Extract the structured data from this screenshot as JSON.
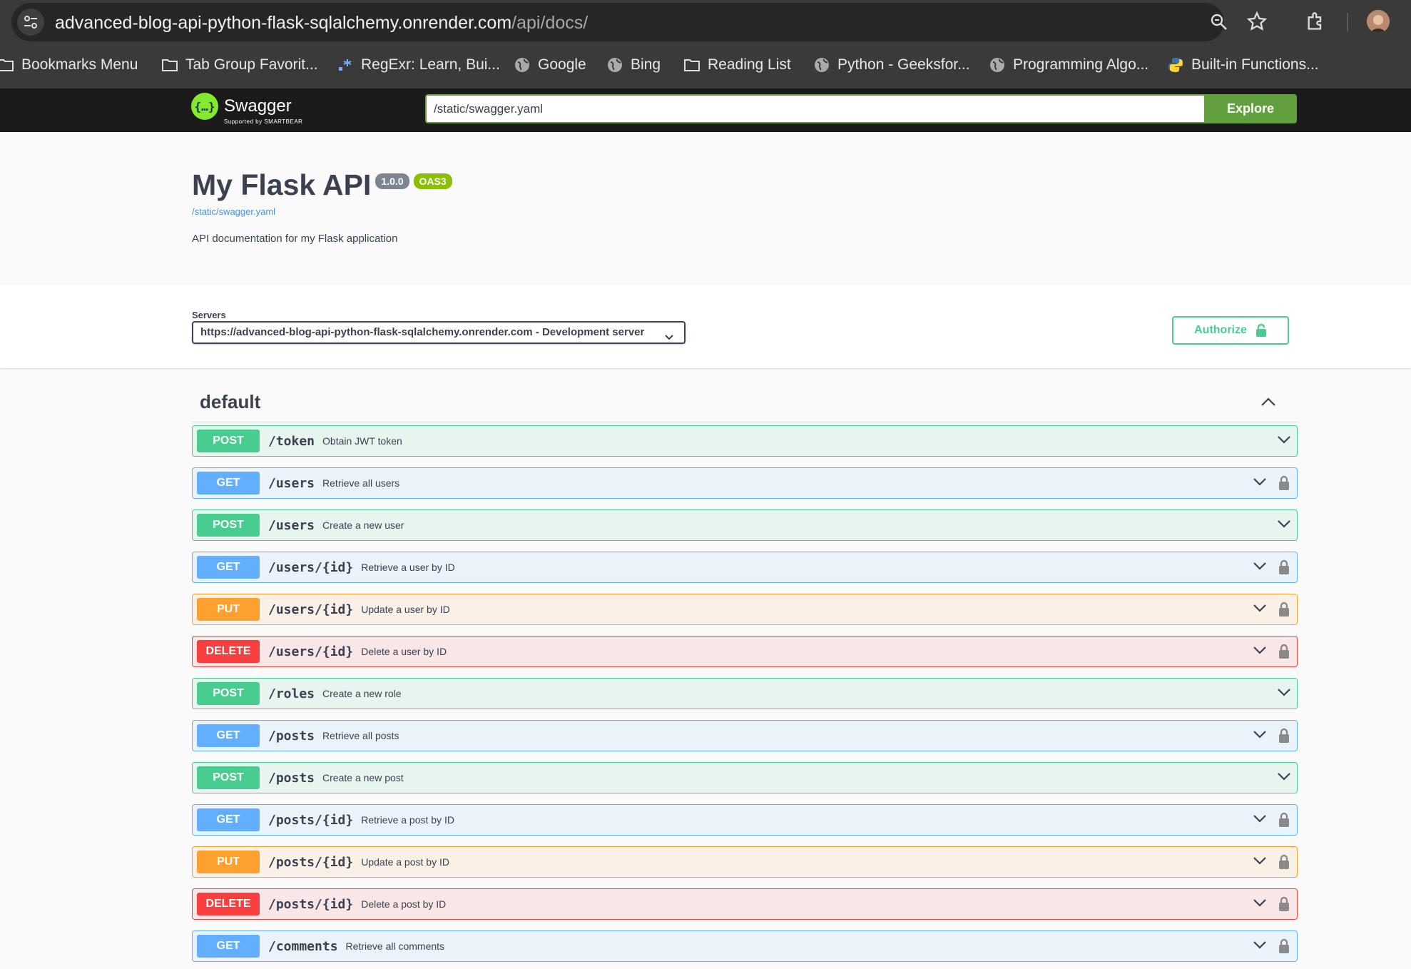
{
  "browser": {
    "url_host": "advanced-blog-api-python-flask-sqlalchemy.onrender.com",
    "url_path": "/api/docs/",
    "bookmarks": [
      {
        "label": "Bookmarks Menu",
        "icon": "folder-icon"
      },
      {
        "label": "Tab Group Favorit...",
        "icon": "folder-icon"
      },
      {
        "label": "RegExr: Learn, Bui...",
        "icon": "regexr-icon"
      },
      {
        "label": "Google",
        "icon": "globe-icon"
      },
      {
        "label": "Bing",
        "icon": "globe-icon"
      },
      {
        "label": "Reading List",
        "icon": "folder-icon"
      },
      {
        "label": "Python - Geeksfor...",
        "icon": "globe-icon"
      },
      {
        "label": "Programming Algo...",
        "icon": "globe-icon"
      },
      {
        "label": "Built-in Functions...",
        "icon": "python-icon"
      }
    ]
  },
  "topbar": {
    "logo_text": "Swagger",
    "logo_sub": "Supported by SMARTBEAR",
    "spec_url": "/static/swagger.yaml",
    "explore_label": "Explore"
  },
  "info": {
    "title": "My Flask API",
    "version": "1.0.0",
    "oas": "OAS3",
    "spec_link": "/static/swagger.yaml",
    "description": "API documentation for my Flask application"
  },
  "scheme": {
    "servers_label": "Servers",
    "server_value": "https://advanced-blog-api-python-flask-sqlalchemy.onrender.com - Development server",
    "authorize_label": "Authorize"
  },
  "tag": {
    "name": "default"
  },
  "operations": [
    {
      "method": "POST",
      "path": "/token",
      "summary": "Obtain JWT token",
      "locked": false
    },
    {
      "method": "GET",
      "path": "/users",
      "summary": "Retrieve all users",
      "locked": true
    },
    {
      "method": "POST",
      "path": "/users",
      "summary": "Create a new user",
      "locked": false
    },
    {
      "method": "GET",
      "path": "/users/{id}",
      "summary": "Retrieve a user by ID",
      "locked": true
    },
    {
      "method": "PUT",
      "path": "/users/{id}",
      "summary": "Update a user by ID",
      "locked": true
    },
    {
      "method": "DELETE",
      "path": "/users/{id}",
      "summary": "Delete a user by ID",
      "locked": true
    },
    {
      "method": "POST",
      "path": "/roles",
      "summary": "Create a new role",
      "locked": false
    },
    {
      "method": "GET",
      "path": "/posts",
      "summary": "Retrieve all posts",
      "locked": true
    },
    {
      "method": "POST",
      "path": "/posts",
      "summary": "Create a new post",
      "locked": false
    },
    {
      "method": "GET",
      "path": "/posts/{id}",
      "summary": "Retrieve a post by ID",
      "locked": true
    },
    {
      "method": "PUT",
      "path": "/posts/{id}",
      "summary": "Update a post by ID",
      "locked": true
    },
    {
      "method": "DELETE",
      "path": "/posts/{id}",
      "summary": "Delete a post by ID",
      "locked": true
    },
    {
      "method": "GET",
      "path": "/comments",
      "summary": "Retrieve all comments",
      "locked": true
    }
  ]
}
